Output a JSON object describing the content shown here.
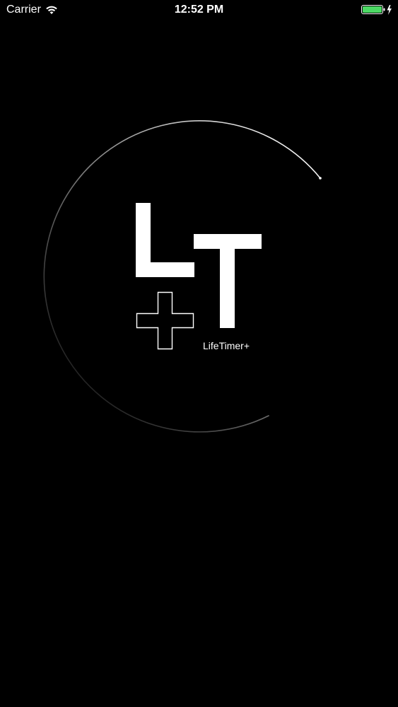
{
  "status_bar": {
    "carrier": "Carrier",
    "time": "12:52 PM",
    "wifi_icon": "wifi-icon",
    "battery_icon": "battery-charging-icon",
    "battery_color": "#4cd964"
  },
  "splash": {
    "logo_letters": "LT",
    "logo_plus_icon": "plus-outline-icon",
    "app_name": "LifeTimer+",
    "ring_icon": "loading-ring-icon",
    "ring_color": "#ffffff",
    "background_color": "#000000"
  }
}
